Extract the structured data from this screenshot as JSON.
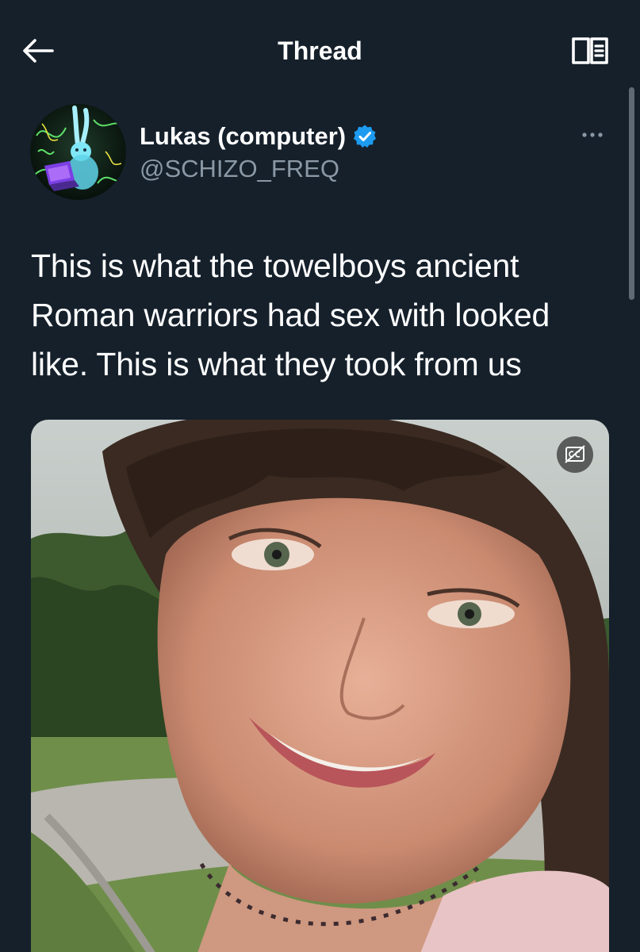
{
  "header": {
    "title": "Thread",
    "back_icon": "arrow-left-icon",
    "reader_icon": "reader-mode-icon"
  },
  "author": {
    "name": "Lukas (computer)",
    "handle": "@SCHIZO_FREQ",
    "verified": true,
    "avatar_icon": "rabbit-avatar-icon"
  },
  "tweet": {
    "text_lines": [
      "This is what the towelboys ancient",
      "Roman warriors had sex with looked",
      "like. This is what they took from us"
    ],
    "media_type": "video",
    "caption_icon": "closed-captions-off-icon"
  },
  "colors": {
    "background": "#15202b",
    "text": "#ffffff",
    "secondary_text": "#8b98a5",
    "verified_blue": "#1d9bf0"
  }
}
